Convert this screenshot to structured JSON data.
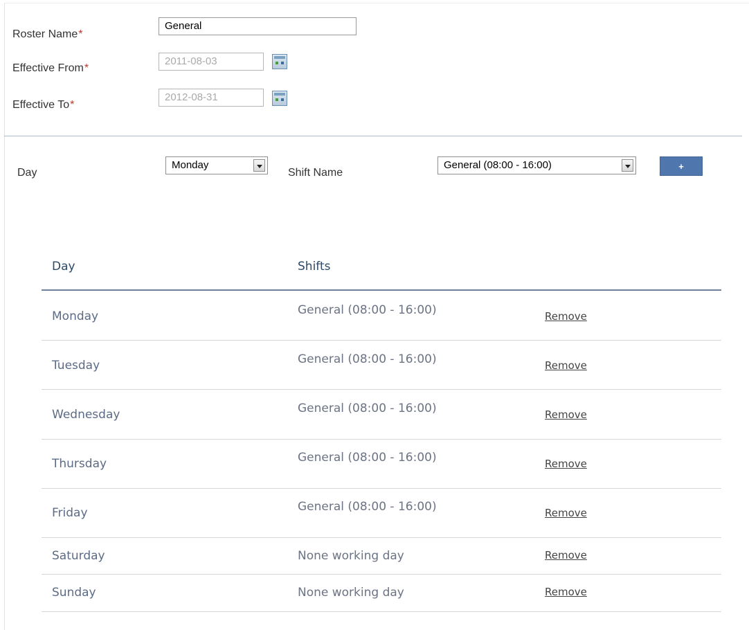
{
  "form": {
    "roster_name_label": "Roster Name",
    "roster_name_value": "General",
    "effective_from_label": "Effective From",
    "effective_from_value": "2011-08-03",
    "effective_to_label": "Effective To",
    "effective_to_value": "2012-08-31",
    "required_marker": "*"
  },
  "picker": {
    "day_label": "Day",
    "day_value": "Monday",
    "shift_label": "Shift Name",
    "shift_value": "General (08:00 - 16:00)",
    "add_label": "+"
  },
  "table": {
    "headers": {
      "day": "Day",
      "shifts": "Shifts"
    },
    "remove_label": "Remove",
    "rows": [
      {
        "day": "Monday",
        "shift": "General (08:00 - 16:00)"
      },
      {
        "day": "Tuesday",
        "shift": "General (08:00 - 16:00)"
      },
      {
        "day": "Wednesday",
        "shift": "General (08:00 - 16:00)"
      },
      {
        "day": "Thursday",
        "shift": "General (08:00 - 16:00)"
      },
      {
        "day": "Friday",
        "shift": "General (08:00 - 16:00)"
      },
      {
        "day": "Saturday",
        "shift": "None working day"
      },
      {
        "day": "Sunday",
        "shift": "None working day"
      }
    ]
  },
  "colors": {
    "accent": "#4f77ad",
    "required": "#c0392b",
    "header_text": "#2d4966"
  },
  "icons": {
    "calendar": "calendar-icon",
    "dropdown": "chevron-down-icon"
  }
}
